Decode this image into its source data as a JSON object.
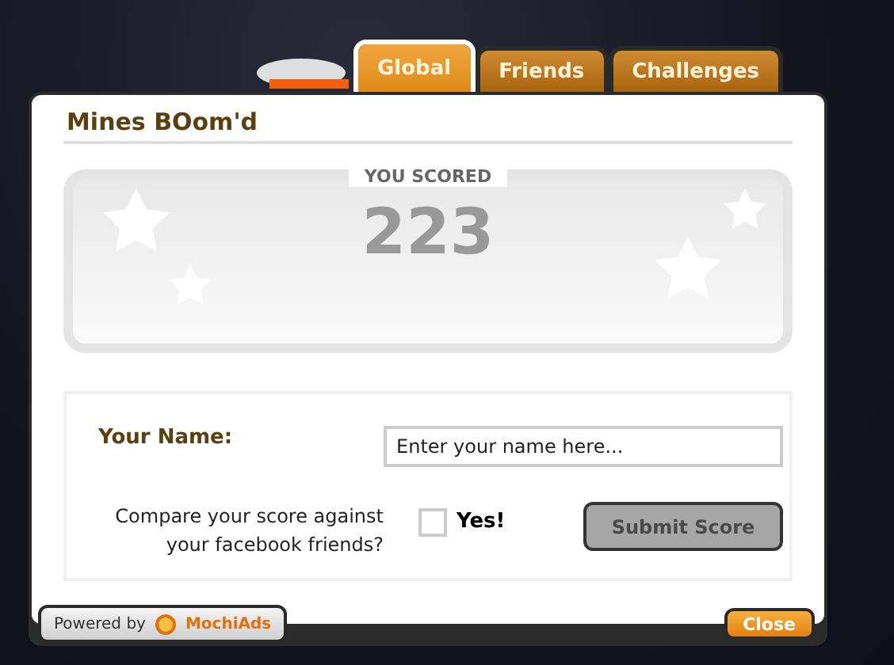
{
  "tabs": [
    {
      "label": "Global",
      "selected": true
    },
    {
      "label": "Friends",
      "selected": false
    },
    {
      "label": "Challenges",
      "selected": false
    }
  ],
  "game_title": "Mines BOom'd",
  "score": {
    "label": "YOU SCORED",
    "value": "223"
  },
  "form": {
    "name_label": "Your Name:",
    "name_placeholder": "Enter your name here...",
    "compare_text": "Compare your score against your facebook friends?",
    "checkbox": {
      "label": "Yes!",
      "checked": false
    },
    "submit": {
      "label": "Submit Score",
      "disabled": true
    }
  },
  "footer": {
    "powered_by": "Powered by",
    "brand": "MochiAds",
    "close": "Close"
  }
}
